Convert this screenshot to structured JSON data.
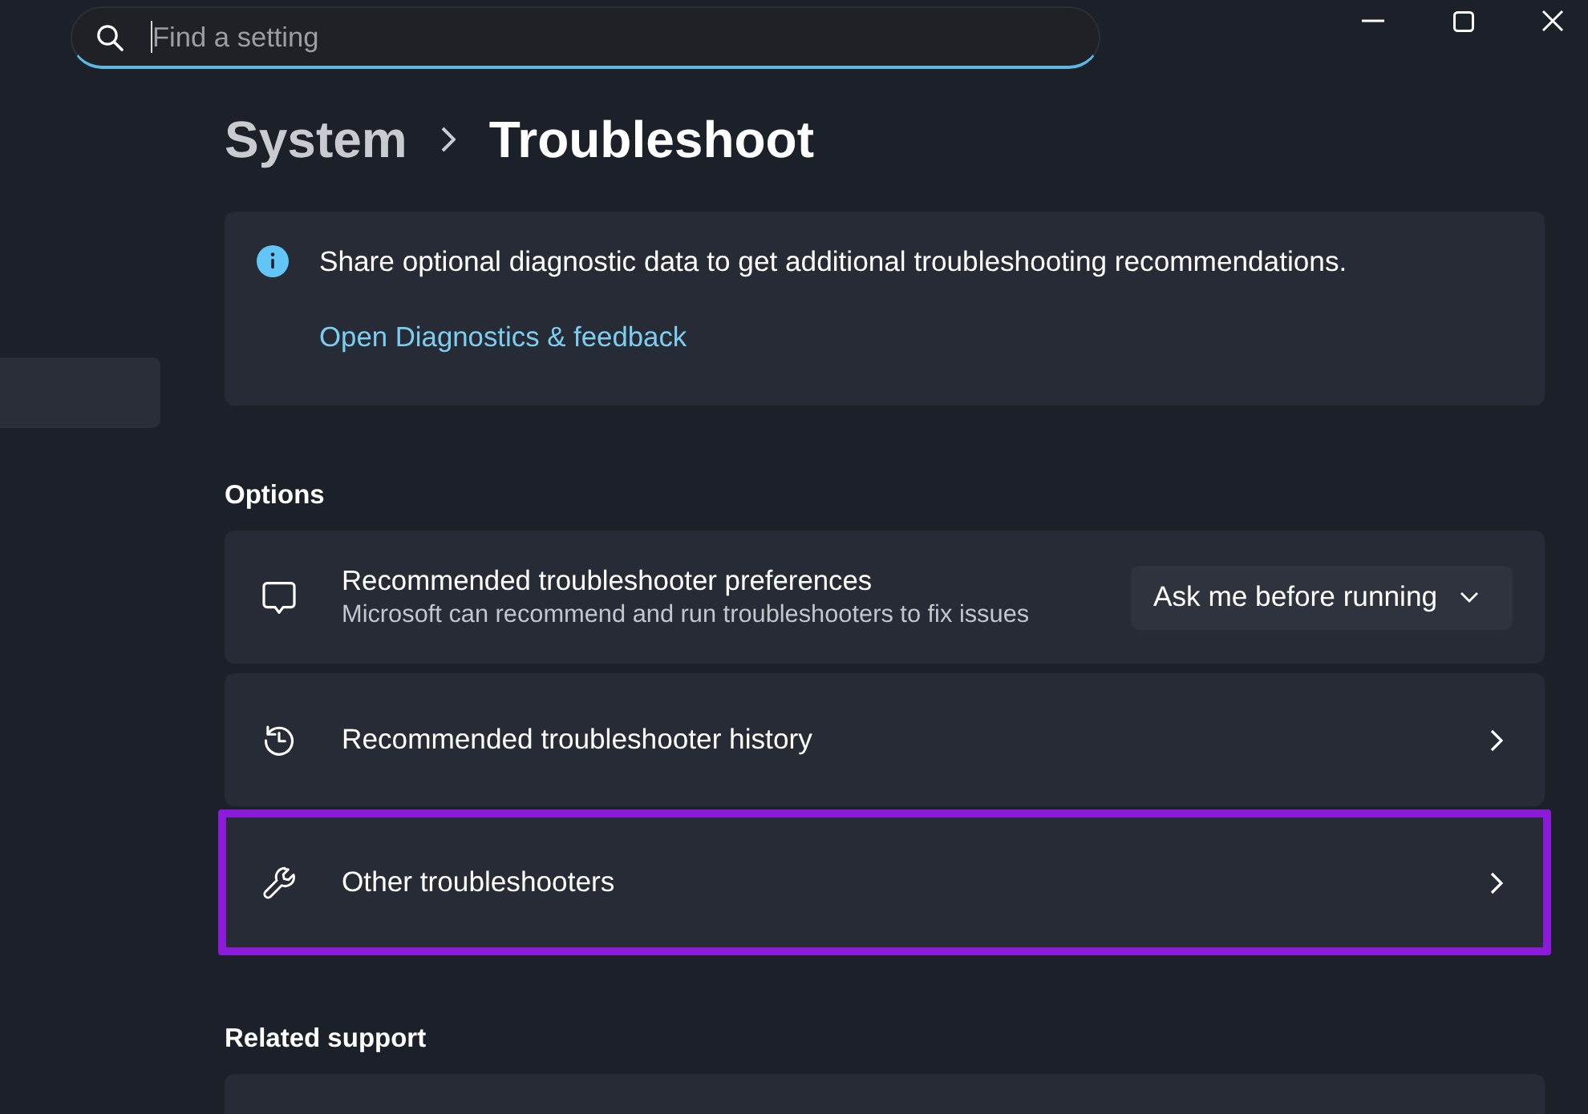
{
  "search": {
    "placeholder": "Find a setting",
    "focused": true
  },
  "sidebar": {
    "items": [
      {
        "selected": true
      }
    ]
  },
  "breadcrumb": [
    {
      "label": "System",
      "current": false
    },
    {
      "label": "Troubleshoot",
      "current": true
    }
  ],
  "info_banner": {
    "text": "Share optional diagnostic data to get additional troubleshooting recommendations.",
    "link": "Open Diagnostics & feedback"
  },
  "sections": [
    {
      "heading": "Options",
      "items": [
        {
          "kind": "dropdown",
          "title": "Recommended troubleshooter preferences",
          "subtitle": "Microsoft can recommend and run troubleshooters to fix issues",
          "value": "Ask me before running",
          "highlighted": false
        },
        {
          "kind": "link",
          "title": "Recommended troubleshooter history",
          "highlighted": false
        },
        {
          "kind": "link",
          "title": "Other troubleshooters",
          "highlighted": true
        }
      ]
    },
    {
      "heading": "Related support",
      "items": [
        {
          "kind": "partial",
          "highlighted": false
        }
      ]
    }
  ]
}
